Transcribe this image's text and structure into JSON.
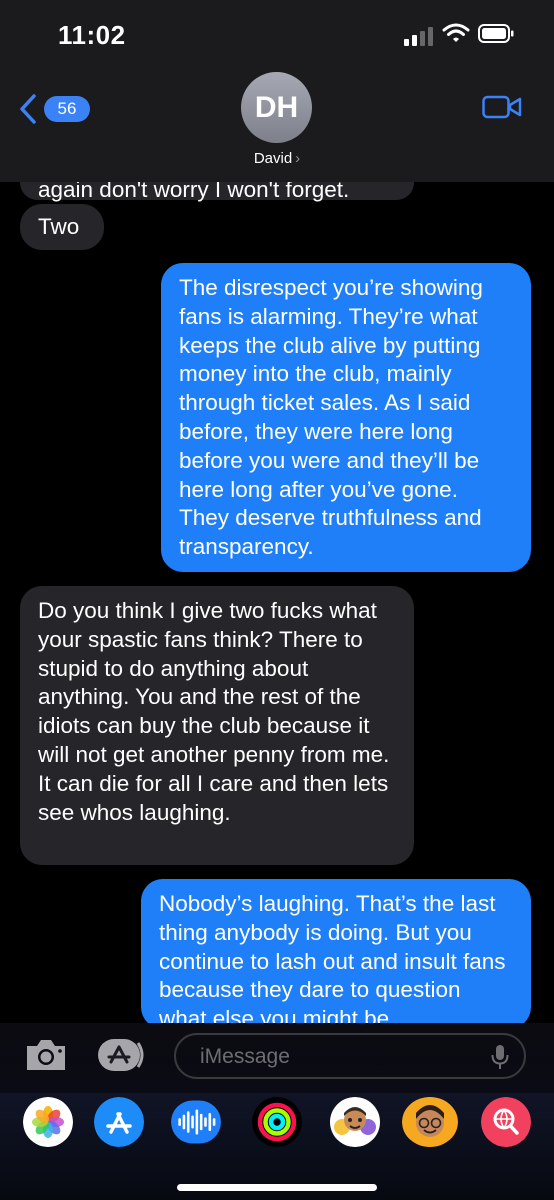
{
  "status_bar": {
    "time": "11:02"
  },
  "header": {
    "back_badge": "56",
    "avatar_initials": "DH",
    "contact_name": "David",
    "contact_chevron": "›"
  },
  "messages": [
    {
      "direction": "incoming",
      "text": "again don't worry I won't forget."
    },
    {
      "direction": "incoming",
      "text": "Two"
    },
    {
      "direction": "outgoing",
      "text": "The disrespect you’re showing fans is alarming. They’re what keeps the club alive by putting money into the club, mainly through ticket sales. As I said before, they were here long before you were and they’ll be here long after you’ve gone. They deserve truthfulness and transparency."
    },
    {
      "direction": "incoming",
      "text": "Do you think I give two fucks what your spastic fans think? There to stupid to do anything about anything. You and the rest of the idiots can buy the club because it will not get another penny from me. It can die for all I care and then lets see whos laughing."
    },
    {
      "direction": "outgoing",
      "text": "Nobody’s laughing. That’s the last thing anybody is doing. But you continue to lash out and insult fans because they dare to question what else you might be"
    }
  ],
  "input": {
    "placeholder": "iMessage"
  },
  "app_drawer": [
    {
      "icon": "photos-icon"
    },
    {
      "icon": "app-store-icon"
    },
    {
      "icon": "audio-message-icon"
    },
    {
      "icon": "fitness-activity-icon"
    },
    {
      "icon": "memoji-stickers-icon"
    },
    {
      "icon": "memoji-icon"
    },
    {
      "icon": "web-search-icon"
    }
  ],
  "colors": {
    "outgoing_bubble": "#1f7ff8",
    "incoming_bubble": "#26252a",
    "accent": "#3b82f6",
    "background": "#000000"
  }
}
